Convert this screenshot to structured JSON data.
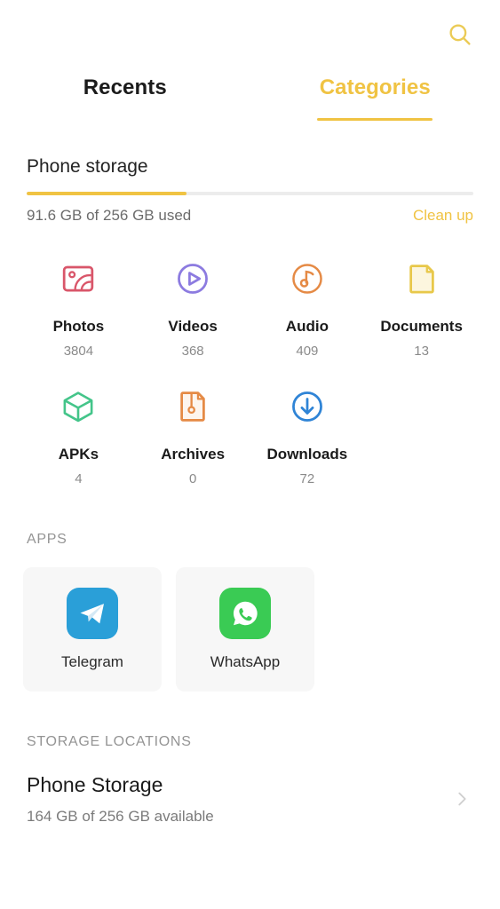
{
  "header": {
    "search_icon": "search-icon"
  },
  "tabs": [
    {
      "label": "Recents",
      "active": false
    },
    {
      "label": "Categories",
      "active": true
    }
  ],
  "storage_summary": {
    "title": "Phone storage",
    "used_text": "91.6 GB of 256 GB used",
    "cleanup_label": "Clean up",
    "percent_used": 35.8,
    "accent_color": "#F0C343",
    "track_color": "#ececec"
  },
  "categories": [
    {
      "label": "Photos",
      "count": "3804",
      "icon": "photos-icon",
      "color": "#D9566A"
    },
    {
      "label": "Videos",
      "count": "368",
      "icon": "videos-icon",
      "color": "#8C7BE0"
    },
    {
      "label": "Audio",
      "count": "409",
      "icon": "audio-icon",
      "color": "#E58A45"
    },
    {
      "label": "Documents",
      "count": "13",
      "icon": "documents-icon",
      "color": "#E8C84A"
    },
    {
      "label": "APKs",
      "count": "4",
      "icon": "apks-icon",
      "color": "#44C58A"
    },
    {
      "label": "Archives",
      "count": "0",
      "icon": "archives-icon",
      "color": "#E58A45"
    },
    {
      "label": "Downloads",
      "count": "72",
      "icon": "downloads-icon",
      "color": "#2F84D6"
    }
  ],
  "apps_section": {
    "heading": "APPS",
    "apps": [
      {
        "name": "Telegram",
        "icon": "telegram-icon",
        "color": "#2A9FD8"
      },
      {
        "name": "WhatsApp",
        "icon": "whatsapp-icon",
        "color": "#3ACB54"
      }
    ]
  },
  "storage_locations": {
    "heading": "STORAGE LOCATIONS",
    "items": [
      {
        "title": "Phone Storage",
        "subtitle": "164 GB of 256 GB available",
        "chevron": "chevron-right-icon"
      }
    ]
  }
}
